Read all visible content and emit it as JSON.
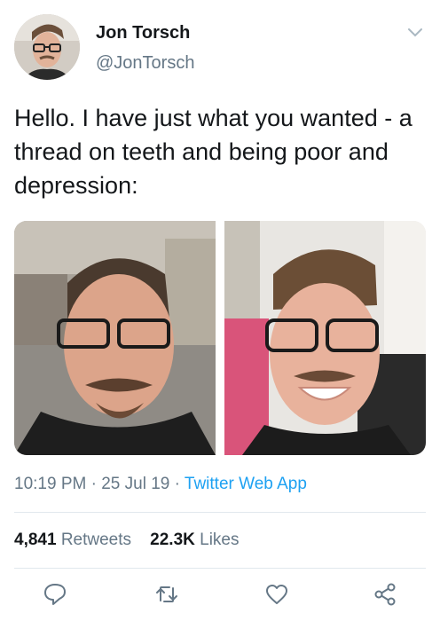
{
  "user": {
    "name": "Jon Torsch",
    "handle": "@JonTorsch"
  },
  "tweet": {
    "text": "Hello. I have just what you wanted - a thread on teeth and being poor and depression:"
  },
  "meta": {
    "time": "10:19 PM",
    "date": "25 Jul 19",
    "source": "Twitter Web App",
    "sep": "·"
  },
  "stats": {
    "retweets_count": "4,841",
    "retweets_label": "Retweets",
    "likes_count": "22.3K",
    "likes_label": "Likes"
  },
  "icons": {
    "reply": "reply-icon",
    "retweet": "retweet-icon",
    "like": "heart-icon",
    "share": "share-icon",
    "menu": "chevron-down-icon"
  },
  "colors": {
    "link": "#1da1f2",
    "muted": "#657786",
    "text": "#14171a"
  }
}
